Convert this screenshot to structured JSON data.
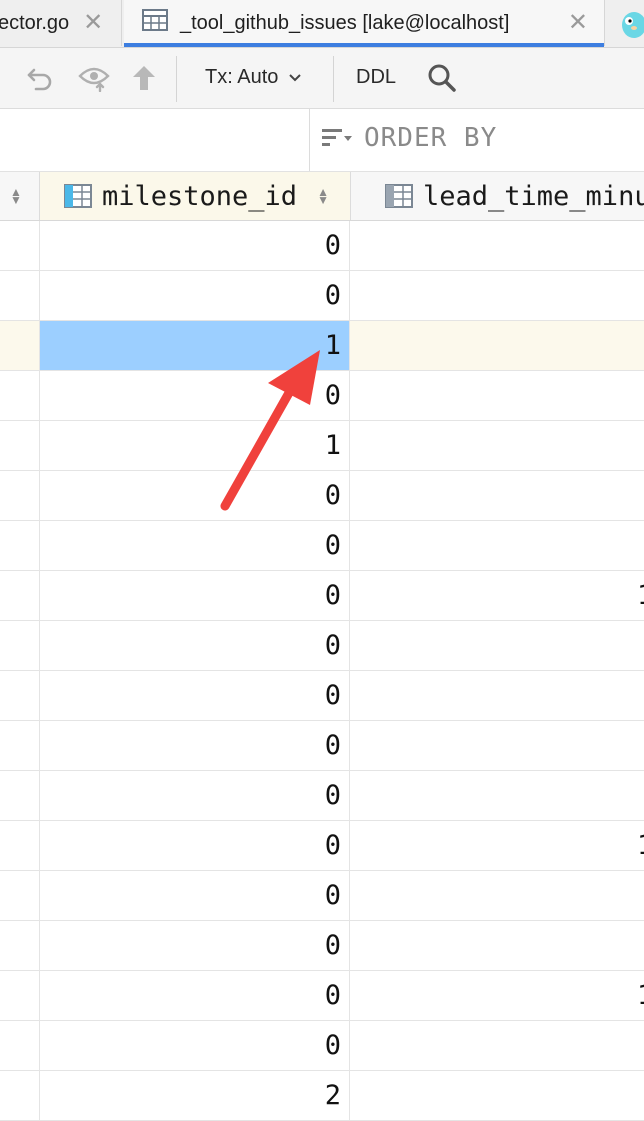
{
  "tabs": [
    {
      "label": "ector.go",
      "active": false
    },
    {
      "label": "_tool_github_issues [lake@localhost]",
      "active": true
    }
  ],
  "toolbar": {
    "tx_label": "Tx: Auto",
    "ddl_label": "DDL"
  },
  "filter": {
    "order_by_placeholder": "ORDER BY"
  },
  "columns": [
    {
      "name": "milestone_id"
    },
    {
      "name": "lead_time_minu"
    }
  ],
  "rows": [
    {
      "milestone_id": "0",
      "lead_time_minutes": ""
    },
    {
      "milestone_id": "0",
      "lead_time_minutes": ""
    },
    {
      "milestone_id": "1",
      "lead_time_minutes": ""
    },
    {
      "milestone_id": "0",
      "lead_time_minutes": ""
    },
    {
      "milestone_id": "1",
      "lead_time_minutes": ""
    },
    {
      "milestone_id": "0",
      "lead_time_minutes": ""
    },
    {
      "milestone_id": "0",
      "lead_time_minutes": ""
    },
    {
      "milestone_id": "0",
      "lead_time_minutes": "1"
    },
    {
      "milestone_id": "0",
      "lead_time_minutes": ""
    },
    {
      "milestone_id": "0",
      "lead_time_minutes": ""
    },
    {
      "milestone_id": "0",
      "lead_time_minutes": ""
    },
    {
      "milestone_id": "0",
      "lead_time_minutes": ""
    },
    {
      "milestone_id": "0",
      "lead_time_minutes": "1"
    },
    {
      "milestone_id": "0",
      "lead_time_minutes": ""
    },
    {
      "milestone_id": "0",
      "lead_time_minutes": ""
    },
    {
      "milestone_id": "0",
      "lead_time_minutes": "1"
    },
    {
      "milestone_id": "0",
      "lead_time_minutes": ""
    },
    {
      "milestone_id": "2",
      "lead_time_minutes": ""
    }
  ],
  "selected_row_index": 2,
  "colors": {
    "selection": "#9ccfff",
    "current_row": "#fcf9ec",
    "annotation_arrow": "#f0413c",
    "active_tab_underline": "#3d7ee0"
  },
  "icons": {
    "table_tab": "table-icon",
    "undo": "revert-icon",
    "preview": "eye-icon",
    "submit": "arrow-up-icon",
    "search": "search-icon",
    "order_by": "sort-lines-icon",
    "go_tab": "gopher-icon"
  }
}
